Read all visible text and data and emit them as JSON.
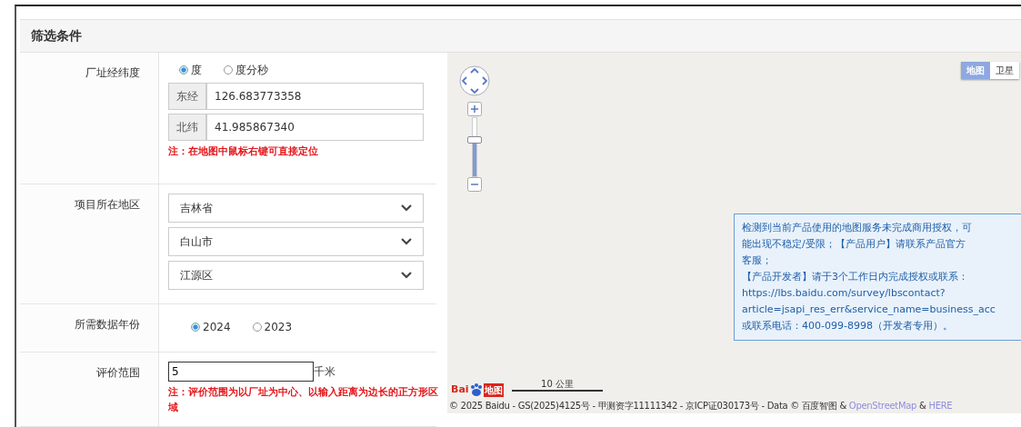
{
  "panel": {
    "title": "筛选条件"
  },
  "rows": [
    {
      "kind": "coords",
      "label": "厂址经纬度",
      "options": [
        {
          "label": "度",
          "selected": true
        },
        {
          "label": "度分秒",
          "selected": false
        }
      ],
      "fields": [
        {
          "addon": "东经",
          "value": "126.683773358"
        },
        {
          "addon": "北纬",
          "value": "41.985867340"
        }
      ],
      "note": "注：在地图中鼠标右键可直接定位"
    },
    {
      "kind": "selects",
      "label": "项目所在地区",
      "selects": [
        "吉林省",
        "白山市",
        "江源区"
      ]
    },
    {
      "kind": "radios",
      "label": "所需数据年份",
      "options": [
        {
          "label": "2024",
          "selected": true
        },
        {
          "label": "2023",
          "selected": false
        }
      ]
    },
    {
      "kind": "range",
      "label": "评价范围",
      "value": "5",
      "unit": "千米",
      "note": "注：评价范围为以厂址为中心、以输入距离为边长的正方形区域"
    }
  ],
  "map": {
    "type_buttons": [
      {
        "label": "地图",
        "selected": true
      },
      {
        "label": "卫星",
        "selected": false
      }
    ],
    "zoom": {
      "level": 0.62
    },
    "notice": [
      "检测到当前产品使用的地图服务未完成商用授权，可",
      "能出现不稳定/受限；【产品用户】请联系产品官方",
      "客服；",
      "【产品开发者】请于3个工作日内完成授权或联系：",
      "https://lbs.baidu.com/survey/lbscontact?",
      "article=jsapi_res_err&service_name=business_acc",
      "或联系电话：400-099-8998（开发者专用）。"
    ],
    "logo": {
      "left": "Bai",
      "right": "地图"
    },
    "scale": "10 公里",
    "copyright": {
      "text": "© 2025 Baidu - GS(2025)4125号 - 甲测资字11111342 - 京ICP证030173号 - Data © 百度智图 &",
      "links": [
        "OpenStreetMap",
        "HERE"
      ],
      "joiner": "&"
    }
  }
}
